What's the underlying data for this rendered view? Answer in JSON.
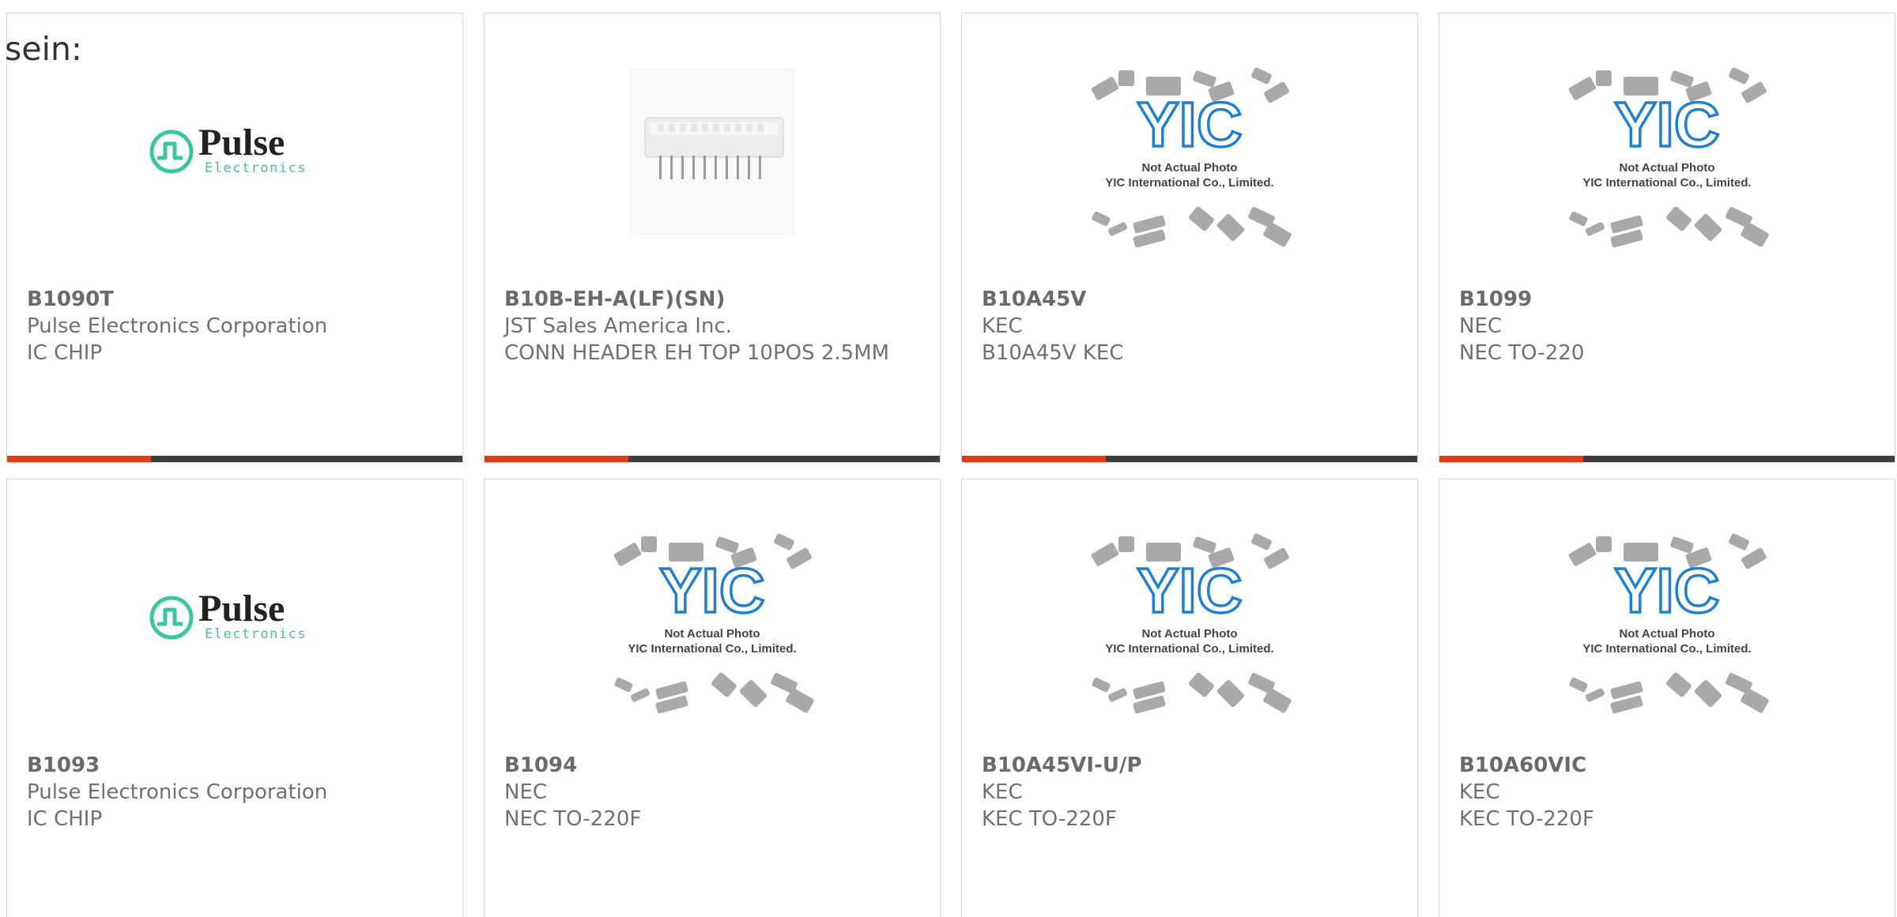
{
  "heading_fragment": "sein:",
  "colors": {
    "accent": "#e43b14",
    "bar": "#3d3d3d",
    "border": "#d4d4d4",
    "text": "#707070",
    "pulse_teal": "#3cc5a3",
    "yic_blue": "#1f7fd0"
  },
  "logos": {
    "pulse_word": "Pulse",
    "pulse_sub": "Electronics",
    "yic_mark": "YIC",
    "yic_line1": "Not Actual Photo",
    "yic_line2": "YIC International Co., Limited."
  },
  "products": [
    {
      "part_number": "B1090T",
      "manufacturer": "Pulse Electronics Corporation",
      "description": "IC CHIP",
      "image": "pulse-logo"
    },
    {
      "part_number": "B10B-EH-A(LF)(SN)",
      "manufacturer": "JST Sales America Inc.",
      "description": "CONN HEADER EH TOP 10POS 2.5MM",
      "image": "connector-photo"
    },
    {
      "part_number": "B10A45V",
      "manufacturer": "KEC",
      "description": "B10A45V KEC",
      "image": "yic-placeholder"
    },
    {
      "part_number": "B1099",
      "manufacturer": "NEC",
      "description": "NEC TO-220",
      "image": "yic-placeholder"
    },
    {
      "part_number": "B1093",
      "manufacturer": "Pulse Electronics Corporation",
      "description": "IC CHIP",
      "image": "pulse-logo"
    },
    {
      "part_number": "B1094",
      "manufacturer": "NEC",
      "description": "NEC TO-220F",
      "image": "yic-placeholder"
    },
    {
      "part_number": "B10A45VI-U/P",
      "manufacturer": "KEC",
      "description": "KEC TO-220F",
      "image": "yic-placeholder"
    },
    {
      "part_number": "B10A60VIC",
      "manufacturer": "KEC",
      "description": "KEC TO-220F",
      "image": "yic-placeholder"
    }
  ]
}
